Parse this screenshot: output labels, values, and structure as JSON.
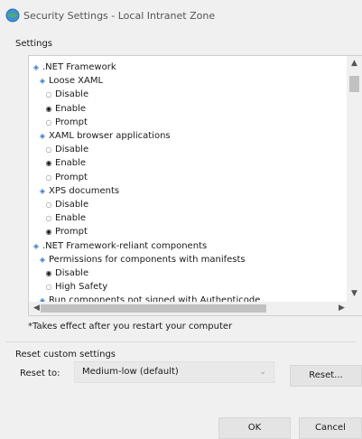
{
  "window": {
    "title": "Security Settings - Local Intranet Zone",
    "icon": "globe-shield-icon"
  },
  "settings": {
    "label": "Settings",
    "tree": [
      {
        "kind": "category",
        "indent": 0,
        "label": ".NET Framework"
      },
      {
        "kind": "category",
        "indent": 1,
        "label": "Loose XAML"
      },
      {
        "kind": "option",
        "indent": 2,
        "label": "Disable",
        "selected": false
      },
      {
        "kind": "option",
        "indent": 2,
        "label": "Enable",
        "selected": true
      },
      {
        "kind": "option",
        "indent": 2,
        "label": "Prompt",
        "selected": false
      },
      {
        "kind": "category",
        "indent": 1,
        "label": "XAML browser applications"
      },
      {
        "kind": "option",
        "indent": 2,
        "label": "Disable",
        "selected": false
      },
      {
        "kind": "option",
        "indent": 2,
        "label": "Enable",
        "selected": true
      },
      {
        "kind": "option",
        "indent": 2,
        "label": "Prompt",
        "selected": false
      },
      {
        "kind": "category",
        "indent": 1,
        "label": "XPS documents"
      },
      {
        "kind": "option",
        "indent": 2,
        "label": "Disable",
        "selected": false
      },
      {
        "kind": "option",
        "indent": 2,
        "label": "Enable",
        "selected": false
      },
      {
        "kind": "option",
        "indent": 2,
        "label": "Prompt",
        "selected": true
      },
      {
        "kind": "category",
        "indent": 0,
        "label": ".NET Framework-reliant components"
      },
      {
        "kind": "category",
        "indent": 1,
        "label": "Permissions for components with manifests"
      },
      {
        "kind": "option",
        "indent": 2,
        "label": "Disable",
        "selected": true
      },
      {
        "kind": "option",
        "indent": 2,
        "label": "High Safety",
        "selected": false
      },
      {
        "kind": "category",
        "indent": 1,
        "label": "Run components not signed with Authenticode"
      }
    ],
    "note": "*Takes effect after you restart your computer"
  },
  "reset": {
    "section_label": "Reset custom settings",
    "reset_to_label": "Reset to:",
    "selected_level": "Medium-low (default)",
    "reset_button": "Reset..."
  },
  "footer": {
    "ok": "OK",
    "cancel": "Cancel"
  }
}
